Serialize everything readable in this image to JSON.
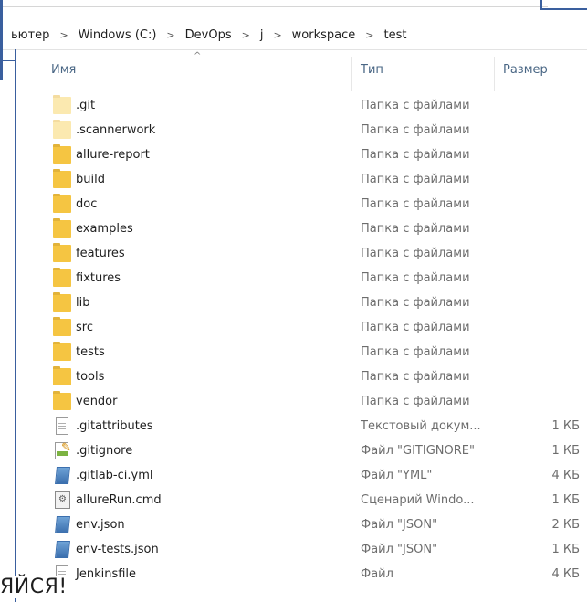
{
  "breadcrumb": [
    "ьютер",
    "Windows (C:)",
    "DevOps",
    "j",
    "workspace",
    "test"
  ],
  "columns": {
    "name": "Имя",
    "type": "Тип",
    "size": "Размер"
  },
  "files": [
    {
      "name": ".git",
      "type": "Папка с файлами",
      "size": "",
      "icon": "folder-faded-icon"
    },
    {
      "name": ".scannerwork",
      "type": "Папка с файлами",
      "size": "",
      "icon": "folder-faded-icon"
    },
    {
      "name": "allure-report",
      "type": "Папка с файлами",
      "size": "",
      "icon": "folder-icon"
    },
    {
      "name": "build",
      "type": "Папка с файлами",
      "size": "",
      "icon": "folder-icon"
    },
    {
      "name": "doc",
      "type": "Папка с файлами",
      "size": "",
      "icon": "folder-icon"
    },
    {
      "name": "examples",
      "type": "Папка с файлами",
      "size": "",
      "icon": "folder-icon"
    },
    {
      "name": "features",
      "type": "Папка с файлами",
      "size": "",
      "icon": "folder-icon"
    },
    {
      "name": "fixtures",
      "type": "Папка с файлами",
      "size": "",
      "icon": "folder-icon"
    },
    {
      "name": "lib",
      "type": "Папка с файлами",
      "size": "",
      "icon": "folder-icon"
    },
    {
      "name": "src",
      "type": "Папка с файлами",
      "size": "",
      "icon": "folder-icon"
    },
    {
      "name": "tests",
      "type": "Папка с файлами",
      "size": "",
      "icon": "folder-icon"
    },
    {
      "name": "tools",
      "type": "Папка с файлами",
      "size": "",
      "icon": "folder-icon"
    },
    {
      "name": "vendor",
      "type": "Папка с файлами",
      "size": "",
      "icon": "folder-icon"
    },
    {
      "name": ".gitattributes",
      "type": "Текстовый докум...",
      "size": "1 КБ",
      "icon": "text-file-icon"
    },
    {
      "name": ".gitignore",
      "type": "Файл \"GITIGNORE\"",
      "size": "1 КБ",
      "icon": "gitignore-file-icon"
    },
    {
      "name": ".gitlab-ci.yml",
      "type": "Файл \"YML\"",
      "size": "4 КБ",
      "icon": "blue-doc-icon"
    },
    {
      "name": "allureRun.cmd",
      "type": "Сценарий Windo...",
      "size": "1 КБ",
      "icon": "cmd-file-icon"
    },
    {
      "name": "env.json",
      "type": "Файл \"JSON\"",
      "size": "2 КБ",
      "icon": "blue-doc-icon"
    },
    {
      "name": "env-tests.json",
      "type": "Файл \"JSON\"",
      "size": "1 КБ",
      "icon": "blue-doc-icon"
    },
    {
      "name": "Jenkinsfile",
      "type": "Файл",
      "size": "4 КБ",
      "icon": "blank-file-icon"
    }
  ],
  "overlay_text": "ЯЙСЯ!"
}
